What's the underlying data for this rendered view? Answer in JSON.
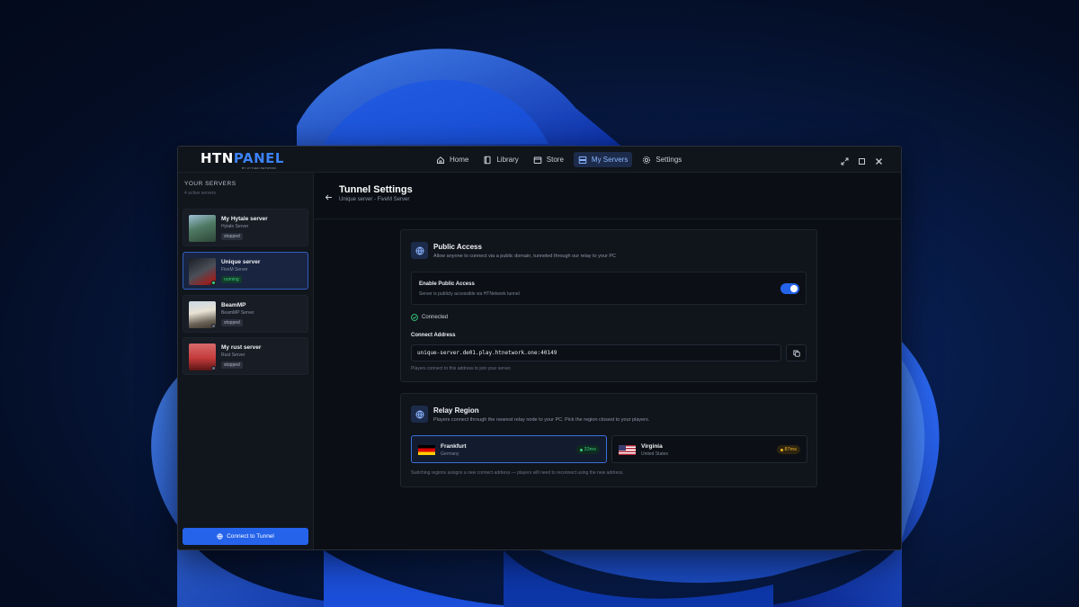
{
  "app": {
    "logo_main": "HTN",
    "logo_accent": "PANEL",
    "logo_sub": "BY HYTHEN NETWORK"
  },
  "nav": {
    "items": [
      {
        "label": "Home",
        "icon": "home-icon"
      },
      {
        "label": "Library",
        "icon": "book-icon"
      },
      {
        "label": "Store",
        "icon": "store-icon"
      },
      {
        "label": "My Servers",
        "icon": "server-icon",
        "active": true
      },
      {
        "label": "Settings",
        "icon": "gear-icon"
      }
    ]
  },
  "sidebar": {
    "title": "YOUR SERVERS",
    "subtitle": "4 active servers",
    "servers": [
      {
        "name": "My Hytale server",
        "type": "Hytale Server",
        "status": "stopped"
      },
      {
        "name": "Unique server",
        "type": "FiveM Server",
        "status": "running",
        "selected": true
      },
      {
        "name": "BeamMP",
        "type": "BeamMP Server",
        "status": "stopped"
      },
      {
        "name": "My rust server",
        "type": "Rust Server",
        "status": "stopped"
      }
    ],
    "connect_button": "Connect to Tunnel"
  },
  "page": {
    "title": "Tunnel Settings",
    "subtitle": "Unique server - FiveM Server"
  },
  "public_access": {
    "title": "Public Access",
    "description": "Allow anyone to connect via a public domain, tunneled through our relay to your PC",
    "toggle_label": "Enable Public Access",
    "toggle_sub": "Server is publicly accessible via HTNetwork tunnel",
    "toggle_on": true,
    "status": "Connected",
    "address_label": "Connect Address",
    "address": "unique-server.de01.play.htnetwork.one:40149",
    "address_help": "Players connect to this address to join your server."
  },
  "relay": {
    "title": "Relay Region",
    "description": "Players connect through the nearest relay node to your PC. Pick the region closest to your players.",
    "regions": [
      {
        "name": "Frankfurt",
        "country": "Germany",
        "ping": "33ms",
        "flag": "de-flag",
        "selected": true
      },
      {
        "name": "Virginia",
        "country": "United States",
        "ping": "87ms",
        "flag": "us-flag"
      }
    ],
    "help": "Switching regions assigns a new connect address — players will need to reconnect using the new address."
  },
  "colors": {
    "accent": "#2563eb",
    "running": "#39d07f",
    "warning": "#f0b429"
  }
}
